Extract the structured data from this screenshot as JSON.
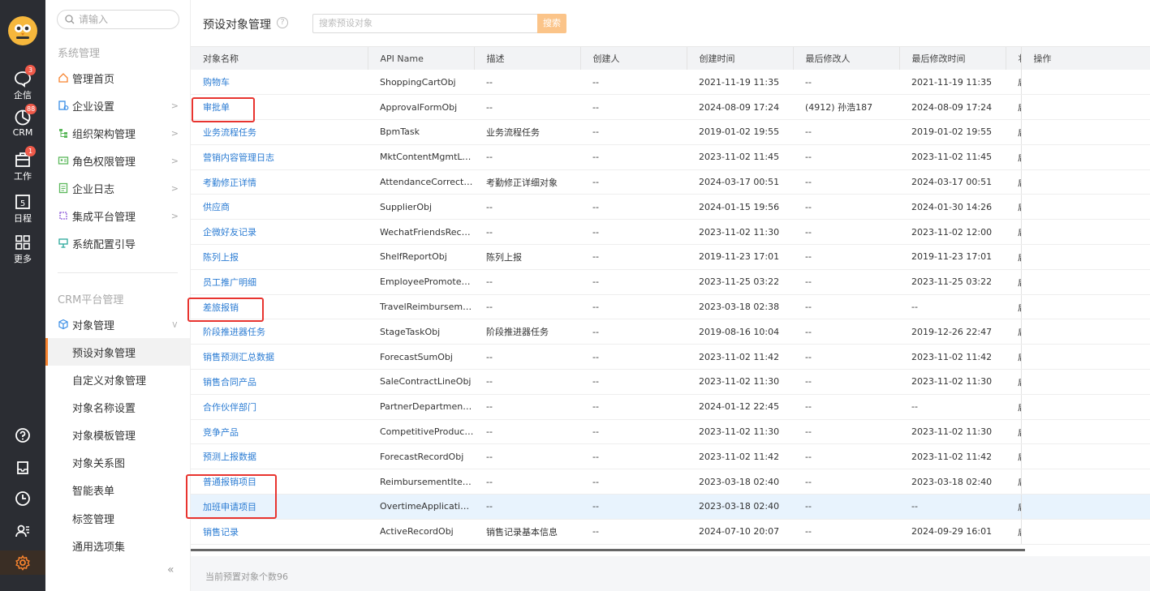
{
  "rail": {
    "items": [
      {
        "label": "企信",
        "badge": "3",
        "icon": "chat-icon"
      },
      {
        "label": "CRM",
        "badge": "88",
        "icon": "crm-icon"
      },
      {
        "label": "工作",
        "badge": "1",
        "icon": "work-icon"
      },
      {
        "label": "日程",
        "badge": "",
        "icon": "calendar-icon",
        "day": "5"
      },
      {
        "label": "更多",
        "badge": "",
        "icon": "grid-icon"
      }
    ]
  },
  "sidebar": {
    "search_placeholder": "请输入",
    "group1": "系统管理",
    "items": [
      {
        "label": "管理首页"
      },
      {
        "label": "企业设置"
      },
      {
        "label": "组织架构管理"
      },
      {
        "label": "角色权限管理"
      },
      {
        "label": "企业日志"
      },
      {
        "label": "集成平台管理"
      },
      {
        "label": "系统配置引导"
      }
    ],
    "group2": "CRM平台管理",
    "object_mgmt": "对象管理",
    "sub_items": [
      {
        "label": "预设对象管理"
      },
      {
        "label": "自定义对象管理"
      },
      {
        "label": "对象名称设置"
      },
      {
        "label": "对象模板管理"
      },
      {
        "label": "对象关系图"
      },
      {
        "label": "智能表单"
      },
      {
        "label": "标签管理"
      },
      {
        "label": "通用选项集"
      }
    ],
    "collapse": "«"
  },
  "main": {
    "title": "预设对象管理",
    "help": "?",
    "search_placeholder": "搜索预设对象",
    "search_button": "搜索",
    "footer": "当前预置对象个数96"
  },
  "table": {
    "headers": [
      "对象名称",
      "API Name",
      "描述",
      "创建人",
      "创建时间",
      "最后修改人",
      "最后修改时间",
      "状",
      "操作"
    ],
    "rows": [
      [
        "购物车",
        "ShoppingCartObj",
        "--",
        "--",
        "2021-11-19 11:35",
        "--",
        "2021-11-19 11:35",
        "启"
      ],
      [
        "审批单",
        "ApprovalFormObj",
        "--",
        "--",
        "2024-08-09 17:24",
        " (4912) 孙浩187",
        "2024-08-09 17:24",
        "启"
      ],
      [
        "业务流程任务",
        "BpmTask",
        "业务流程任务",
        "--",
        "2019-01-02 19:55",
        "--",
        "2019-01-02 19:55",
        "启"
      ],
      [
        "营销内容管理日志",
        "MktContentMgmtLogObj",
        "--",
        "--",
        "2023-11-02 11:45",
        "--",
        "2023-11-02 11:45",
        "启"
      ],
      [
        "考勤修正详情",
        "AttendanceCorrectD...",
        "考勤修正详细对象",
        "--",
        "2024-03-17 00:51",
        "--",
        "2024-03-17 00:51",
        "启"
      ],
      [
        "供应商",
        "SupplierObj",
        "--",
        "--",
        "2024-01-15 19:56",
        "--",
        "2024-01-30 14:26",
        "启"
      ],
      [
        "企微好友记录",
        "WechatFriendsRecor...",
        "--",
        "--",
        "2023-11-02 11:30",
        "--",
        "2023-11-02 12:00",
        "启"
      ],
      [
        "陈列上报",
        "ShelfReportObj",
        "陈列上报",
        "--",
        "2019-11-23 17:01",
        "--",
        "2019-11-23 17:01",
        "启"
      ],
      [
        "员工推广明细",
        "EmployeePromoteDet...",
        "--",
        "--",
        "2023-11-25 03:22",
        "--",
        "2023-11-25 03:22",
        "启"
      ],
      [
        "差旅报销",
        "TravelReimbursemen...",
        "--",
        "--",
        "2023-03-18 02:38",
        "--",
        "--",
        "启"
      ],
      [
        "阶段推进器任务",
        "StageTaskObj",
        "阶段推进器任务",
        "--",
        "2019-08-16 10:04",
        "--",
        "2019-12-26 22:47",
        "启"
      ],
      [
        "销售预测汇总数据",
        "ForecastSumObj",
        "--",
        "--",
        "2023-11-02 11:42",
        "--",
        "2023-11-02 11:42",
        "启"
      ],
      [
        "销售合同产品",
        "SaleContractLineObj",
        "--",
        "--",
        "2023-11-02 11:30",
        "--",
        "2023-11-02 11:30",
        "启"
      ],
      [
        "合作伙伴部门",
        "PartnerDepartmentObj",
        "--",
        "--",
        "2024-01-12 22:45",
        "--",
        "--",
        "启"
      ],
      [
        "竞争产品",
        "CompetitiveProductsObj",
        "--",
        "--",
        "2023-11-02 11:30",
        "--",
        "2023-11-02 11:30",
        "启"
      ],
      [
        "预测上报数据",
        "ForecastRecordObj",
        "--",
        "--",
        "2023-11-02 11:42",
        "--",
        "2023-11-02 11:42",
        "启"
      ],
      [
        "普通报销项目",
        "ReimbursementItemObj",
        "--",
        "--",
        "2023-03-18 02:40",
        "--",
        "2023-03-18 02:40",
        "启"
      ],
      [
        "加班申请项目",
        "OvertimeApplicationIt...",
        "--",
        "--",
        "2023-03-18 02:40",
        "--",
        "--",
        "启"
      ],
      [
        "销售记录",
        "ActiveRecordObj",
        "销售记录基本信息",
        "--",
        "2024-07-10 20:07",
        "--",
        "2024-09-29 16:01",
        "启"
      ]
    ],
    "highlighted_row": 17
  },
  "colors": {
    "rail_bg": "#2b2d33",
    "accent": "#f7832e",
    "link": "#2b7cd3",
    "badge": "#f05a4a",
    "annotation": "#e8342f",
    "row_highlight": "#e8f3fd"
  }
}
